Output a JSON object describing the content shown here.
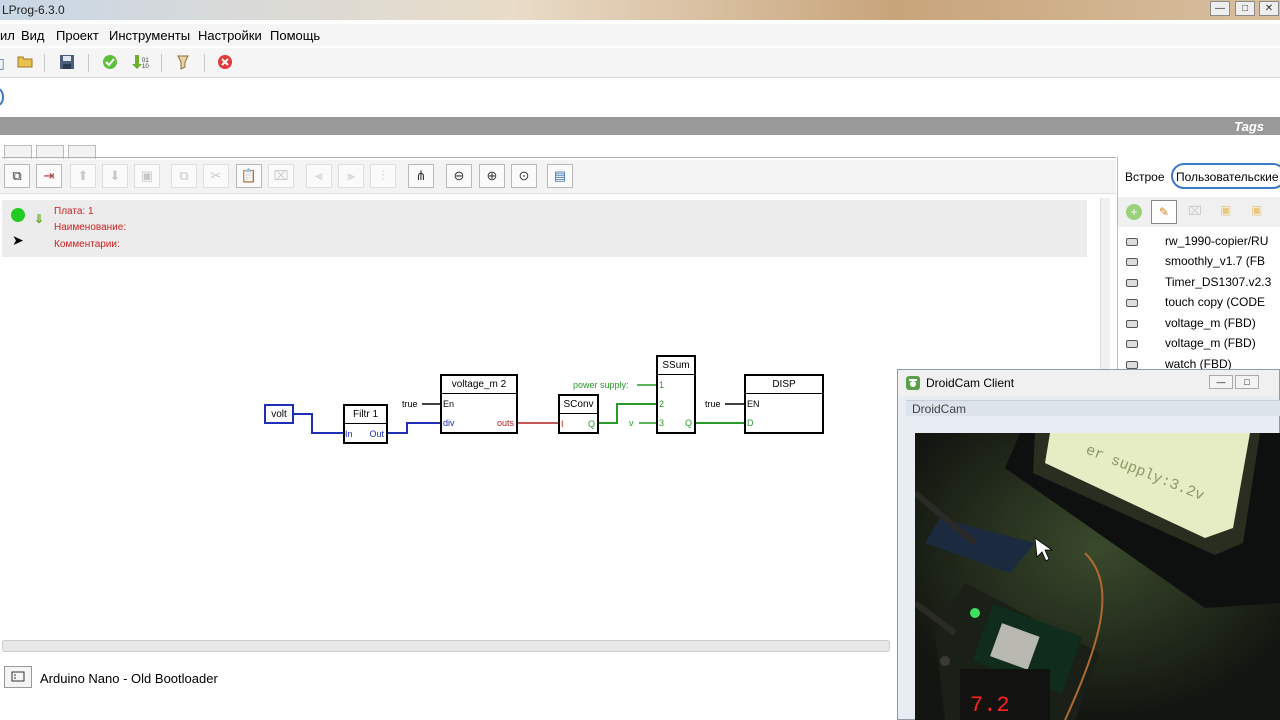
{
  "window": {
    "title": "LProg-6.3.0",
    "controls": [
      "—",
      "□",
      "✕"
    ]
  },
  "menu": {
    "items": [
      "ил",
      "Вид",
      "Проект",
      "Инструменты",
      "Настройки",
      "Помощь"
    ]
  },
  "tags_bar": {
    "label": "Tags"
  },
  "info_panel": {
    "board": "Плата: 1",
    "name": "Наименование:",
    "comment": "Комментарии:",
    "status_color": "#22cc22"
  },
  "diagram": {
    "blocks": {
      "volt": "volt",
      "filtr": {
        "title": "Filtr 1",
        "in": "In",
        "out": "Out"
      },
      "voltage": {
        "title": "voltage_m 2",
        "en": "En",
        "div": "div",
        "outs": "outs",
        "true_label": "true"
      },
      "sconv": {
        "title": "SConv",
        "i": "I",
        "q": "Q"
      },
      "ssum": {
        "title": "SSum",
        "p1": "1",
        "p2": "2",
        "p3": "3",
        "q": "Q",
        "ps_label": "power supply:",
        "v_label": "v"
      },
      "disp": {
        "title": "DISP",
        "en": "EN",
        "d": "D",
        "true_label": "true"
      }
    },
    "colors": {
      "blue": "#1f2fb5",
      "green": "#2a9a2a",
      "red": "#b02020"
    }
  },
  "right_panel": {
    "tab_builtin": "Встрое",
    "tab_user": "Пользовательские",
    "items": [
      "rw_1990-copier/RU",
      "smoothly_v1.7 (FB",
      "Timer_DS1307.v2.3",
      "touch copy (CODE",
      "voltage_m (FBD)",
      "voltage_m (FBD)",
      "watch (FBD)"
    ]
  },
  "status": {
    "board": "Arduino Nano - Old Bootloader"
  },
  "droidcam": {
    "title": "DroidCam Client",
    "subtitle": "DroidCam",
    "lcd_text": "er supply:3.2v",
    "led_text": "7.2"
  }
}
